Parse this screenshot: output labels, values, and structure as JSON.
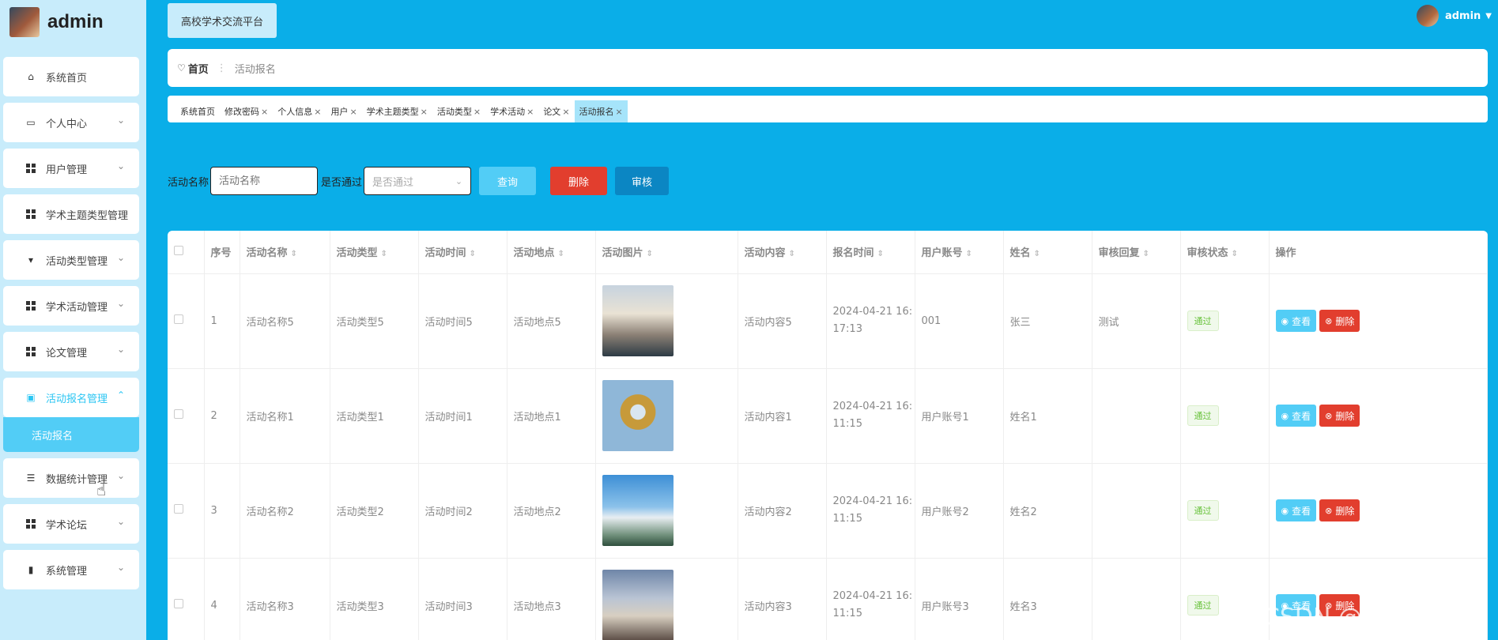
{
  "brand": {
    "name": "admin"
  },
  "sidebar": {
    "items": [
      {
        "label": "系统首页",
        "icon": "home-icon",
        "has_chevron": false
      },
      {
        "label": "个人中心",
        "icon": "card-icon",
        "has_chevron": true
      },
      {
        "label": "用户管理",
        "icon": "grid-icon",
        "has_chevron": true
      },
      {
        "label": "学术主题类型管理",
        "icon": "grid-icon",
        "has_chevron": false
      },
      {
        "label": "活动类型管理",
        "icon": "pin-icon",
        "has_chevron": true
      },
      {
        "label": "学术活动管理",
        "icon": "grid-icon",
        "has_chevron": true
      },
      {
        "label": "论文管理",
        "icon": "grid-icon",
        "has_chevron": true
      },
      {
        "label": "活动报名管理",
        "icon": "clipboard-icon",
        "has_chevron": true,
        "active": true
      },
      {
        "label": "数据统计管理",
        "icon": "list-icon",
        "has_chevron": true
      },
      {
        "label": "学术论坛",
        "icon": "grid-icon",
        "has_chevron": true
      },
      {
        "label": "系统管理",
        "icon": "bar-chart-icon",
        "has_chevron": true
      }
    ],
    "submenu_active": "活动报名"
  },
  "header": {
    "site_title": "高校学术交流平台",
    "user": "admin"
  },
  "breadcrumb": {
    "home": "首页",
    "current": "活动报名"
  },
  "tags": [
    {
      "label": "系统首页",
      "closable": false
    },
    {
      "label": "修改密码",
      "closable": true
    },
    {
      "label": "个人信息",
      "closable": true
    },
    {
      "label": "用户",
      "closable": true
    },
    {
      "label": "学术主题类型",
      "closable": true
    },
    {
      "label": "活动类型",
      "closable": true
    },
    {
      "label": "学术活动",
      "closable": true
    },
    {
      "label": "论文",
      "closable": true
    },
    {
      "label": "活动报名",
      "closable": true,
      "active": true
    }
  ],
  "search": {
    "name_label": "活动名称",
    "name_placeholder": "活动名称",
    "approved_label": "是否通过",
    "approved_placeholder": "是否通过",
    "query_btn": "查询",
    "delete_btn": "删除",
    "audit_btn": "审核"
  },
  "table": {
    "headers": [
      "序号",
      "活动名称",
      "活动类型",
      "活动时间",
      "活动地点",
      "活动图片",
      "活动内容",
      "报名时间",
      "用户账号",
      "姓名",
      "审核回复",
      "审核状态",
      "操作"
    ],
    "rows": [
      {
        "no": "1",
        "name": "活动名称5",
        "type": "活动类型5",
        "time": "活动时间5",
        "place": "活动地点5",
        "content": "活动内容5",
        "signup_date": "2024-04-21 16:",
        "signup_time": "17:13",
        "account": "001",
        "realname": "张三",
        "reply": "测试",
        "status": "通过",
        "view": "查看",
        "del": "删除"
      },
      {
        "no": "2",
        "name": "活动名称1",
        "type": "活动类型1",
        "time": "活动时间1",
        "place": "活动地点1",
        "content": "活动内容1",
        "signup_date": "2024-04-21 16:",
        "signup_time": "11:15",
        "account": "用户账号1",
        "realname": "姓名1",
        "reply": "",
        "status": "通过",
        "view": "查看",
        "del": "删除"
      },
      {
        "no": "3",
        "name": "活动名称2",
        "type": "活动类型2",
        "time": "活动时间2",
        "place": "活动地点2",
        "content": "活动内容2",
        "signup_date": "2024-04-21 16:",
        "signup_time": "11:15",
        "account": "用户账号2",
        "realname": "姓名2",
        "reply": "",
        "status": "通过",
        "view": "查看",
        "del": "删除"
      },
      {
        "no": "4",
        "name": "活动名称3",
        "type": "活动类型3",
        "time": "活动时间3",
        "place": "活动地点3",
        "content": "活动内容3",
        "signup_date": "2024-04-21 16:",
        "signup_time": "11:15",
        "account": "用户账号3",
        "realname": "姓名3",
        "reply": "",
        "status": "通过",
        "view": "查看",
        "del": "删除"
      }
    ]
  },
  "watermark": "CSDN @计算机学姐",
  "colors": {
    "accent": "#0aaee8",
    "sidebar": "#c8ecfb",
    "danger": "#e23e2e",
    "info": "#52cdf6",
    "audit": "#0b86c3",
    "success": "#67c23a"
  }
}
